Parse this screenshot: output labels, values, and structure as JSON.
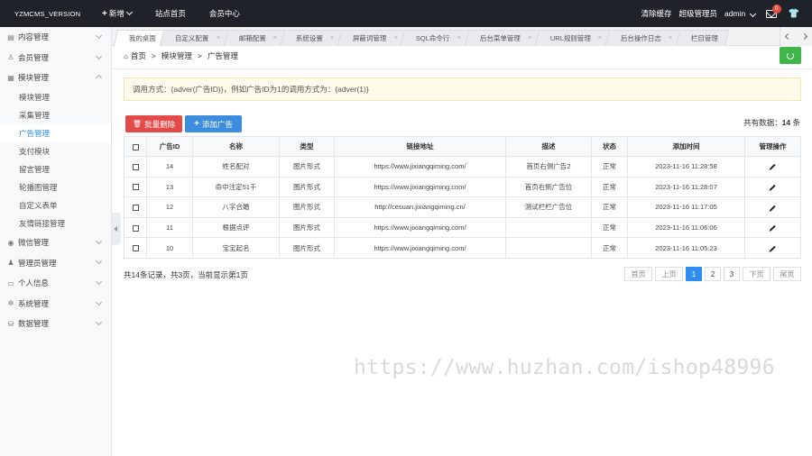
{
  "topbar": {
    "brand": "YZMCMS_VERSION",
    "nav": [
      {
        "label": "新增",
        "has_plus": true,
        "has_dropdown": true
      },
      {
        "label": "站点首页"
      },
      {
        "label": "会员中心"
      }
    ],
    "clear_cache": "清除缓存",
    "role": "超级管理员",
    "user": "admin",
    "message_count": "0"
  },
  "sidebar": {
    "menus": [
      {
        "label": "内容管理",
        "icon": "document-icon",
        "expanded": false
      },
      {
        "label": "会员管理",
        "icon": "user-icon",
        "expanded": false
      },
      {
        "label": "模块管理",
        "icon": "grid-icon",
        "expanded": true,
        "children": [
          "模块管理",
          "采集管理",
          "广告管理",
          "支付模块",
          "留言管理",
          "轮播图管理",
          "自定义表单",
          "友情链接管理"
        ]
      },
      {
        "label": "微信管理",
        "icon": "wechat-icon",
        "expanded": false
      },
      {
        "label": "管理员管理",
        "icon": "admin-icon",
        "expanded": false
      },
      {
        "label": "个人信息",
        "icon": "id-card-icon",
        "expanded": false
      },
      {
        "label": "系统管理",
        "icon": "gear-icon",
        "expanded": false
      },
      {
        "label": "数据管理",
        "icon": "database-icon",
        "expanded": false
      }
    ],
    "active_child": "广告管理"
  },
  "tabs": [
    "我的桌面",
    "自定义配置",
    "邮箱配置",
    "系统设置",
    "屏蔽词管理",
    "SQL命令行",
    "后台菜单管理",
    "URL规则管理",
    "后台操作日志",
    "栏目管理"
  ],
  "breadcrumb": {
    "home": "首页",
    "parent": "模块管理",
    "current": "广告管理"
  },
  "tip": "调用方式：{adver(广告ID)}，例如广告ID为1的调用方式为：{adver(1)}",
  "toolbar": {
    "delete_label": "批量删除",
    "add_label": "添加广告",
    "total_label": "共有数据：",
    "total_value": "14",
    "total_unit": "条"
  },
  "table": {
    "columns": [
      "广告ID",
      "名称",
      "类型",
      "链接地址",
      "描述",
      "状态",
      "添加时间",
      "管理操作"
    ],
    "rows": [
      {
        "id": "14",
        "name": "姓名配对",
        "type": "图片形式",
        "url": "https://www.jixiangqiming.com/",
        "desc": "首页右侧广告2",
        "status": "正常",
        "time": "2023-11-16 11:28:58"
      },
      {
        "id": "13",
        "name": "命中注定51千",
        "type": "图片形式",
        "url": "https://www.jixiangqiming.com/",
        "desc": "首页右侧广告位",
        "status": "正常",
        "time": "2023-11-16 11:28:07"
      },
      {
        "id": "12",
        "name": "八字合婚",
        "type": "图片形式",
        "url": "http://cesuan.jixiangqiming.cn/",
        "desc": "测试栏栏广告位",
        "status": "正常",
        "time": "2023-11-16 11:17:05"
      },
      {
        "id": "11",
        "name": "根据点评",
        "type": "图片形式",
        "url": "https://www.jixiangqiming.com/",
        "desc": "",
        "status": "正常",
        "time": "2023-11-16 11:06:06"
      },
      {
        "id": "10",
        "name": "宝宝起名",
        "type": "图片形式",
        "url": "https://www.jixiangqiming.com/",
        "desc": "",
        "status": "正常",
        "time": "2023-11-16 11:05:23"
      }
    ]
  },
  "footer": {
    "records": "共14条记录，共3页，当前显示第1页"
  },
  "pager": {
    "first": "首页",
    "prev": "上页",
    "pages": [
      "1",
      "2",
      "3"
    ],
    "current": "1",
    "next": "下页",
    "last": "尾页"
  },
  "watermark": "https://www.huzhan.com/ishop48996",
  "colors": {
    "topbar": "#1f2329",
    "accent": "#2e8ded",
    "danger": "#e34b4b",
    "primary": "#3c8dde",
    "success": "#3fb64a",
    "tip_bg": "#fffbea"
  }
}
